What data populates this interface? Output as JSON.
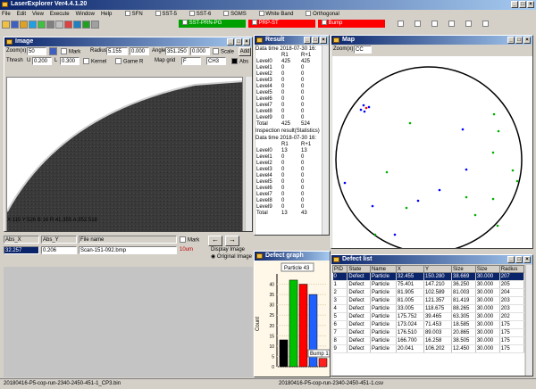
{
  "app_title": "LaserExplorer Ver4.4.1.20",
  "menu": [
    "File",
    "Edit",
    "View",
    "Execute",
    "Window",
    "Help"
  ],
  "toolbar": {
    "toggles": [
      "SFN",
      "SST-5",
      "SST-6",
      "SGMS",
      "White Band",
      "Orthogonal"
    ],
    "status_boxes": [
      {
        "label": "SST-PRN-PG",
        "color": "#00a000"
      },
      {
        "label": "PRP-ST",
        "color": "#ff0000"
      },
      {
        "label": "Bump",
        "color": "#ff0000"
      }
    ]
  },
  "image_window": {
    "title": "Image",
    "zoom_label": "Zoom(x)",
    "zoom_value": "50",
    "mark_label": "Mark",
    "radius_label": "Radius",
    "radius_value": "5.155",
    "radius_unit": "0.000",
    "angle_label": "Angle",
    "angle_value": "351.250",
    "angle_unit": "0.000",
    "scale_label": "Scale",
    "add_label": "Add",
    "thresh_label": "Thresh",
    "thresh_u": "U",
    "thresh_u_val": "0.200",
    "thresh_l": "L",
    "thresh_l_val": "0.300",
    "kernel_label": "Kernel",
    "game_label": "Game R",
    "map_label": "Map grid",
    "map_value": "F",
    "ch_value": "CH3",
    "abs_label": "Abs",
    "coords": "X:115 Y:526  B:16  R:41.355  A:352.518"
  },
  "file_panel": {
    "headers": [
      "Abs_X",
      "Abs_Y",
      "File name"
    ],
    "row": {
      "abs_x": "32.257",
      "abs_y": "0.206",
      "file": "Scan-151-092.bmp"
    },
    "mark_label": "Mark",
    "prev": "←",
    "next": "→",
    "unit": "10um",
    "display_label": "Display Image",
    "display_option": "Original Image"
  },
  "result_window": {
    "title": "Result",
    "section1_time": "Data time 2018-07-30 16:",
    "headers": [
      "",
      "R1",
      "R+1"
    ],
    "rows1": [
      [
        "Level0",
        "425",
        "425"
      ],
      [
        "Level1",
        "0",
        "0"
      ],
      [
        "Level2",
        "0",
        "0"
      ],
      [
        "Level3",
        "0",
        "0"
      ],
      [
        "Level4",
        "0",
        "0"
      ],
      [
        "Level5",
        "0",
        "0"
      ],
      [
        "Level6",
        "0",
        "0"
      ],
      [
        "Level7",
        "0",
        "0"
      ],
      [
        "Level8",
        "0",
        "0"
      ],
      [
        "Level9",
        "0",
        "0"
      ],
      [
        "Total",
        "425",
        "524"
      ]
    ],
    "section2_label": "Inspection result(Statistics)",
    "section2_time": "Data time 2018-07-30 16:",
    "rows2": [
      [
        "Level0",
        "13",
        "13"
      ],
      [
        "Level1",
        "0",
        "0"
      ],
      [
        "Level2",
        "0",
        "0"
      ],
      [
        "Level3",
        "0",
        "0"
      ],
      [
        "Level4",
        "0",
        "0"
      ],
      [
        "Level5",
        "0",
        "0"
      ],
      [
        "Level6",
        "0",
        "0"
      ],
      [
        "Level7",
        "0",
        "0"
      ],
      [
        "Level8",
        "0",
        "0"
      ],
      [
        "Level9",
        "0",
        "0"
      ],
      [
        "Total",
        "13",
        "43"
      ]
    ]
  },
  "map_window": {
    "title": "Map",
    "zoom_label": "Zoom(x)",
    "zoom_value": "CC"
  },
  "defect_graph": {
    "title": "Defect graph",
    "legend_top": "Particle 43",
    "legend_bottom": "Bump 1",
    "ylabel": "Count"
  },
  "defect_list": {
    "title": "Defect list",
    "headers": [
      "PID",
      "State",
      "Name",
      "X",
      "Y",
      "Size",
      "Size",
      "Radius"
    ],
    "rows": [
      [
        "0",
        "Defect",
        "Particle",
        "32.455",
        "150.280",
        "38.669",
        "30.000",
        "207"
      ],
      [
        "1",
        "Defect",
        "Particle",
        "75.401",
        "147.210",
        "36.250",
        "30.000",
        "205"
      ],
      [
        "2",
        "Defect",
        "Particle",
        "81.905",
        "102.589",
        "81.003",
        "30.000",
        "204"
      ],
      [
        "3",
        "Defect",
        "Particle",
        "81.005",
        "121.357",
        "81.419",
        "30.000",
        "203"
      ],
      [
        "4",
        "Defect",
        "Particle",
        "33.005",
        "118.675",
        "88.265",
        "30.000",
        "203"
      ],
      [
        "5",
        "Defect",
        "Particle",
        "175.752",
        "39.465",
        "63.305",
        "30.000",
        "202"
      ],
      [
        "6",
        "Defect",
        "Particle",
        "173.024",
        "71.453",
        "18.585",
        "30.000",
        "175"
      ],
      [
        "7",
        "Defect",
        "Particle",
        "176.510",
        "89.003",
        "20.865",
        "30.000",
        "175"
      ],
      [
        "8",
        "Defect",
        "Particle",
        "166.700",
        "16.258",
        "38.505",
        "30.000",
        "175"
      ],
      [
        "9",
        "Defect",
        "Particle",
        "20.041",
        "106.202",
        "12.450",
        "30.000",
        "175"
      ]
    ]
  },
  "chart_data": {
    "type": "bar",
    "title": "",
    "ylabel": "Count",
    "ylim": [
      0,
      45
    ],
    "yticks": [
      0,
      5,
      10,
      15,
      20,
      25,
      30,
      35,
      40
    ],
    "series": [
      {
        "name": "",
        "values": [
          13,
          42,
          40,
          35,
          4
        ],
        "colors": [
          "#000000",
          "#00c000",
          "#ff0000",
          "#2060ff",
          "#ff2020"
        ]
      }
    ],
    "categories": [
      "",
      "",
      "",
      "",
      ""
    ],
    "annotations": [
      "Particle 43",
      "Bump 1"
    ]
  },
  "status_bar": {
    "left": "20180416-P5-cop-run-2340-2450-451-1_CP3.bin",
    "right": "20180416-P5-cop-run-2340-2450-451-1.csv"
  },
  "colors": {
    "accent_title": "#0a246a",
    "selection": "#0a246a",
    "background": "#d4d0c8"
  }
}
